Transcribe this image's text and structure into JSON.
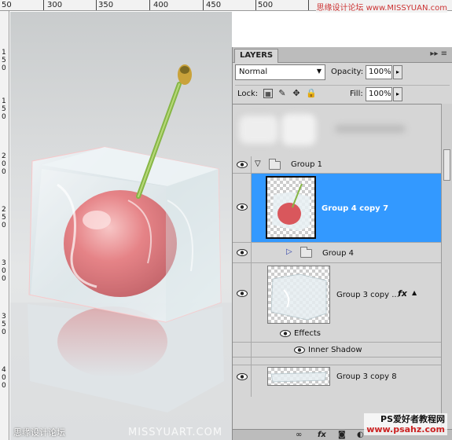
{
  "ruler": {
    "top_labels": [
      "50",
      "300",
      "350",
      "400",
      "450",
      "500"
    ],
    "left_labels": [
      "1",
      "5",
      "0",
      "1",
      "5",
      "0",
      "2",
      "0",
      "0",
      "2",
      "5",
      "0",
      "3",
      "0",
      "0",
      "3",
      "5",
      "0",
      "4",
      "0",
      "0"
    ]
  },
  "watermarks": {
    "top_right": "思缘设计论坛 www.MISSYUAN.com",
    "bottom_left": "思缘设计论坛",
    "bottom_mid": "MISSYUART.COM",
    "bottom_right_line1": "PS爱好者教程网",
    "bottom_right_line2": "www.psahz.com"
  },
  "layers_panel": {
    "tab_label": "LAYERS",
    "menu_glyph": "▸▸ ≡",
    "blend_mode": "Normal",
    "opacity_label": "Opacity:",
    "opacity_value": "100%",
    "lock_label": "Lock:",
    "fill_label": "Fill:",
    "fill_value": "100%",
    "layers": [
      {
        "name": "Group 1",
        "type": "group",
        "expanded": true
      },
      {
        "name": "Group 4 copy 7",
        "type": "layer",
        "selected": true
      },
      {
        "name": "Group 4",
        "type": "group",
        "expanded": false
      },
      {
        "name": "Group 3 copy ...",
        "type": "layer",
        "fx": "fx"
      },
      {
        "name": "Effects",
        "type": "effects-header"
      },
      {
        "name": "Inner Shadow",
        "type": "effect"
      },
      {
        "name": "Group 3 copy 8",
        "type": "layer"
      }
    ]
  },
  "colors": {
    "selection": "#3399ff",
    "panel_bg": "#d6d6d6"
  }
}
